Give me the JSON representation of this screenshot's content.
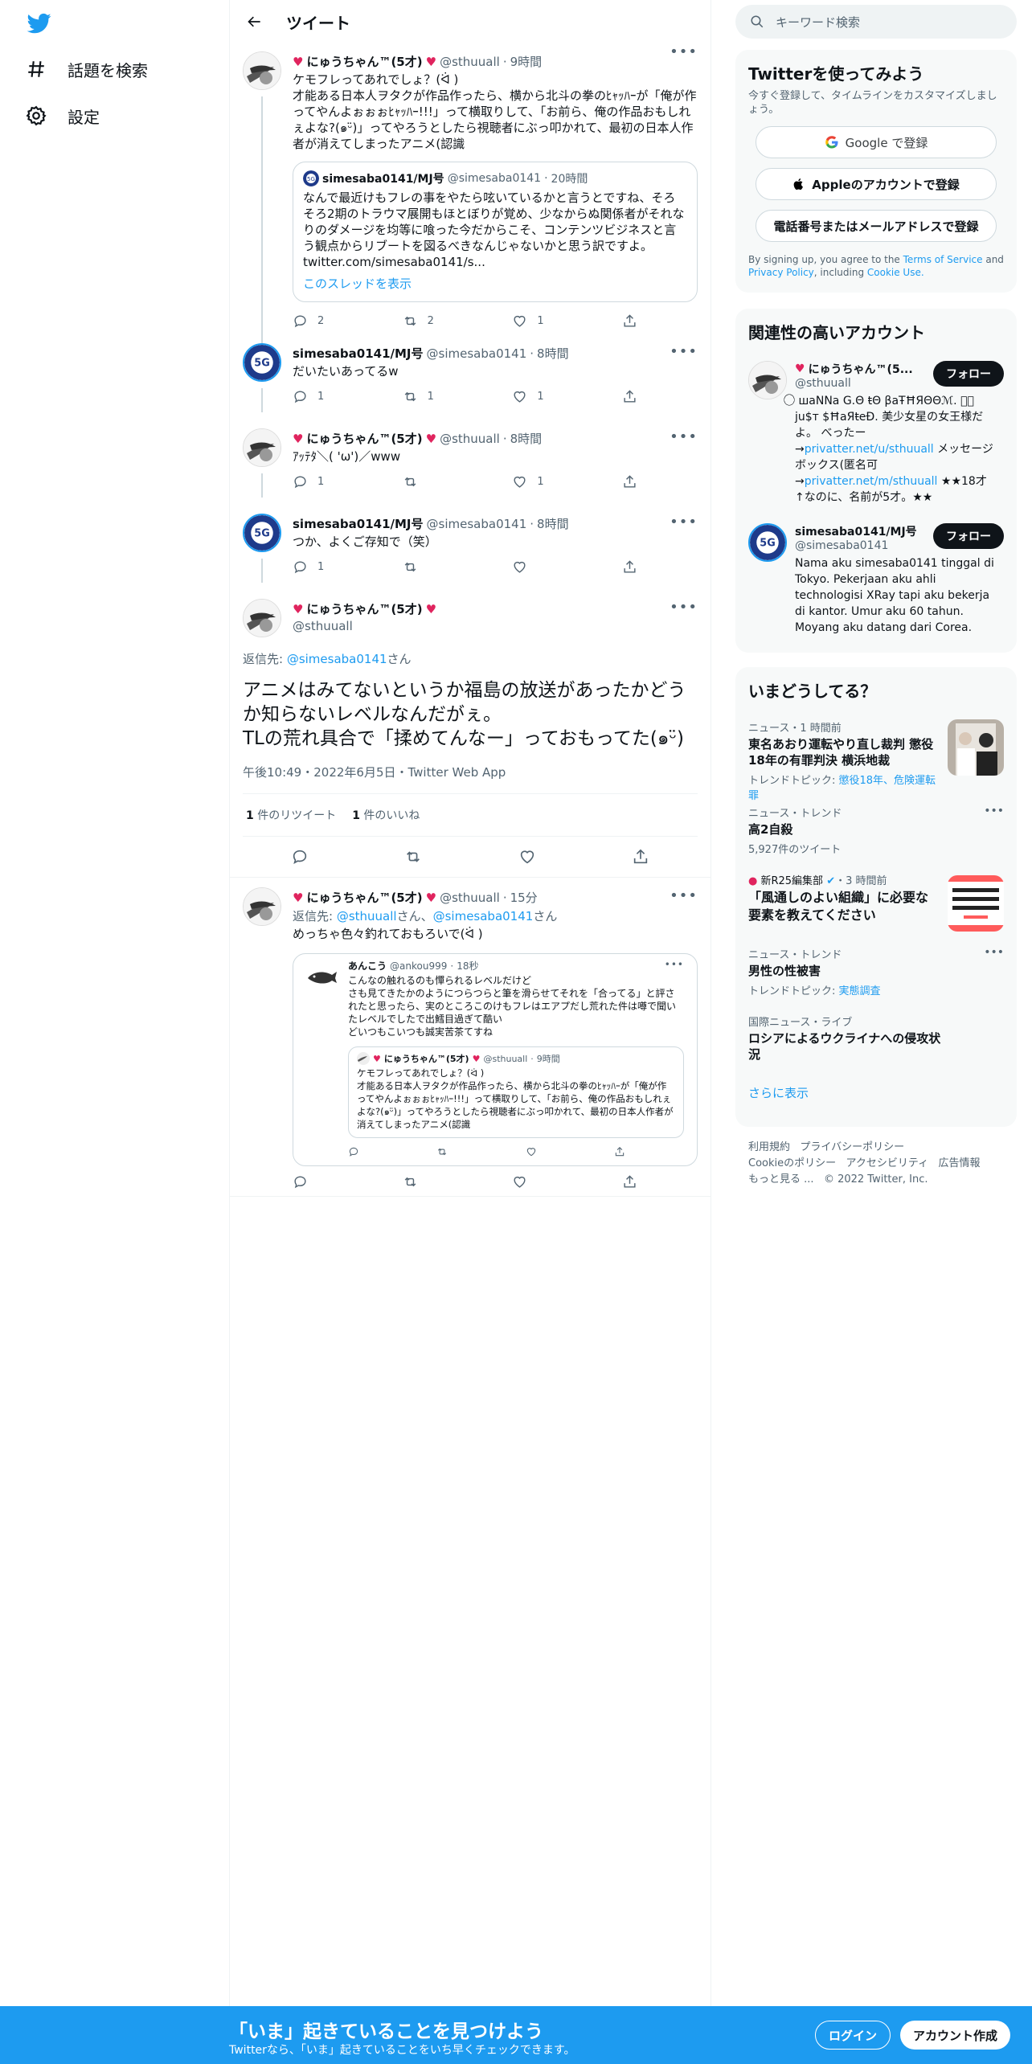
{
  "nav": {
    "explore_label": "話題を検索",
    "settings_label": "設定"
  },
  "header": {
    "title": "ツイート"
  },
  "thread": [
    {
      "name": "にゅうちゃん™(5才)",
      "handle": "@sthuuall",
      "time": "9時間",
      "text": "ケモフレってあれでしょ？(ᐛ )\n才能ある日本人ヲタクが作品作ったら、横から北斗の拳のﾋｬｯﾊｰが「俺が作ってやんよぉぉぉﾋｬｯﾊｰ!!!」って横取りして、「お前ら、俺の作品おもしれぇよな?(๑ᵕ̈)」ってやろうとしたら視聴者にぶっ叩かれて、最初の日本人作者が消えてしまったアニメ(認識",
      "quote": {
        "name": "simesaba0141/MJ号",
        "handle": "@simesaba0141",
        "time": "20時間",
        "text": "なんで最近けもフレの事をやたら呟いているかと言うとですね、そろそろ2期のトラウマ展開もほとぼりが覚め、少なからぬ関係者がそれなりのダメージを均等に喰った今だからこそ、コンテンツビジネスと言う観点からリブートを図るべきなんじゃないかと思う訳ですよ。\ntwitter.com/simesaba0141/s...",
        "show_thread": "このスレッドを表示"
      },
      "replies": "2",
      "retweets": "2",
      "likes": "1"
    },
    {
      "name": "simesaba0141/MJ号",
      "handle": "@simesaba0141",
      "time": "8時間",
      "text": "だいたいあってるw",
      "replies": "1",
      "retweets": "1",
      "likes": "1"
    },
    {
      "name": "にゅうちゃん™(5才)",
      "handle": "@sthuuall",
      "time": "8時間",
      "text": "ｱｯﾃﾀ＼( 'ω')／www",
      "replies": "1",
      "retweets": "",
      "likes": "1"
    },
    {
      "name": "simesaba0141/MJ号",
      "handle": "@simesaba0141",
      "time": "8時間",
      "text": "つか、よくご存知で（笑）",
      "replies": "1",
      "retweets": "",
      "likes": ""
    }
  ],
  "focal": {
    "name": "にゅうちゃん™(5才)",
    "handle": "@sthuuall",
    "reply_to_prefix": "返信先: ",
    "reply_to_handle": "@simesaba0141",
    "reply_to_suffix": "さん",
    "text": "アニメはみてないというか福島の放送があったかどうか知らないレベルなんだがぇ。\nTLの荒れ具合で「揉めてんなー」っておもってた(๑ᵕ̈)",
    "timestamp": "午後10:49・2022年6月5日・Twitter Web App",
    "retweet_count": "1",
    "retweet_label": " 件のリツイート",
    "like_count": "1",
    "like_label": " 件のいいね"
  },
  "reply": {
    "name": "にゅうちゃん™(5才)",
    "handle": "@sthuuall",
    "time": "15分",
    "reply_to_prefix": "返信先: ",
    "reply_to_handle1": "@sthuuall",
    "reply_to_mid": "さん、",
    "reply_to_handle2": "@simesaba0141",
    "reply_to_suffix": "さん",
    "text": "めっちゃ色々釣れておもろいで(ᐛ )",
    "quote": {
      "name": "あんこう",
      "handle": "@ankou999",
      "time": "18秒",
      "text": "こんなの触れるのも憚られるレベルだけど\nさも見てきたかのようにつらつらと筆を滑らせてそれを「合ってる」と評されたと思ったら、実のところこのけもフレはエアプだし荒れた件は噂で聞いたレベルでしたで出鱈目過ぎて酷い\nどいつもこいつも誠実苦茶てすね",
      "inner": {
        "name": "にゅうちゃん™(5才)",
        "handle": "@sthuuall",
        "time": "9時間",
        "text": "ケモフレってあれでしょ？(ᐛ )\n才能ある日本人ヲタクが作品作ったら、横から北斗の拳のﾋｬｯﾊｰが「俺が作ってやんよぉぉぉﾋｬｯﾊｰ!!!」って横取りして、「お前ら、俺の作品おもしれぇよな?(๑ᵕ̈)」ってやろうとしたら視聴者にぶっ叩かれて、最初の日本人作者が消えてしまったアニメ(認識"
      }
    }
  },
  "right": {
    "search_placeholder": "キーワード検索",
    "signup": {
      "title": "Twitterを使ってみよう",
      "subtitle": "今すぐ登録して、タイムラインをカスタマイズしましょう。",
      "google": "Google で登録",
      "apple": "Appleのアカウントで登録",
      "phone": "電話番号またはメールアドレスで登録",
      "terms_pre": "By signing up, you agree to the ",
      "terms_tos": "Terms of Service",
      "terms_and": " and ",
      "terms_privacy": "Privacy Policy",
      "terms_incl": ", including ",
      "terms_cookie": "Cookie Use."
    },
    "related": {
      "title": "関連性の高いアカウント",
      "follow": "フォロー",
      "accounts": [
        {
          "name": "にゅうちゃん™(5...",
          "handle": "@sthuuall",
          "bio1": "⃝⃝ шaNNa G.Θ ŧΘ βaŦĦЯΘΘℳ. ⃝⃝ ju$т $ĦaЯŧeÐ. 美少女星の女王様だよ。 べったー →",
          "bio_link1": "privatter.net/u/sthuuall",
          "bio2": " メッセージボックス(匿名可 →",
          "bio_link2": "privatter.net/m/sthuuall",
          "bio3": " ★★18才↑なのに、名前が5才。★★"
        },
        {
          "name": "simesaba0141/MJ号",
          "handle": "@simesaba0141",
          "bio": "Nama aku simesaba0141 tinggal di Tokyo. Pekerjaan aku ahli technologisi XRay tapi aku bekerja di kantor. Umur aku 60 tahun. Moyang aku datang dari Corea."
        }
      ]
    },
    "trends": {
      "title": "いまどうしてる？",
      "items": [
        {
          "context": "ニュース・1 時間前",
          "title": "東名あおり運転やり直し裁判 懲役18年の有罪判決 横浜地裁",
          "sub_label": "トレンドトピック: ",
          "sub_links": "懲役18年、危険運転罪"
        },
        {
          "context": "ニュース・トレンド",
          "title": "高2自殺",
          "sub": "5,927件のツイート"
        },
        {
          "context": "新R25編集部",
          "context_time": "・3 時間前",
          "title": "「風通しのよい組織」に必要な要素を教えてください"
        },
        {
          "context": "ニュース・トレンド",
          "title": "男性の性被害",
          "sub_label": "トレンドトピック: ",
          "sub_links": "実態調査"
        },
        {
          "context": "国際ニュース・ライブ",
          "title": "ロシアによるウクライナへの侵攻状況"
        }
      ],
      "show_more": "さらに表示"
    },
    "footer": {
      "terms": "利用規約",
      "privacy": "プライバシーポリシー",
      "cookie": "Cookieのポリシー",
      "accessibility": "アクセシビリティ",
      "ads": "広告情報",
      "more": "もっと見る ...",
      "copyright": "© 2022 Twitter, Inc."
    }
  },
  "bottom_bar": {
    "title": "「いま」起きていることを見つけよう",
    "subtitle": "Twitterなら、「いま」起きていることをいち早くチェックできます。",
    "login": "ログイン",
    "signup": "アカウント作成"
  },
  "colors": {
    "accent": "#1d9bf0",
    "text": "#0f1419",
    "secondary": "#536471",
    "heart": "#e0245e"
  }
}
